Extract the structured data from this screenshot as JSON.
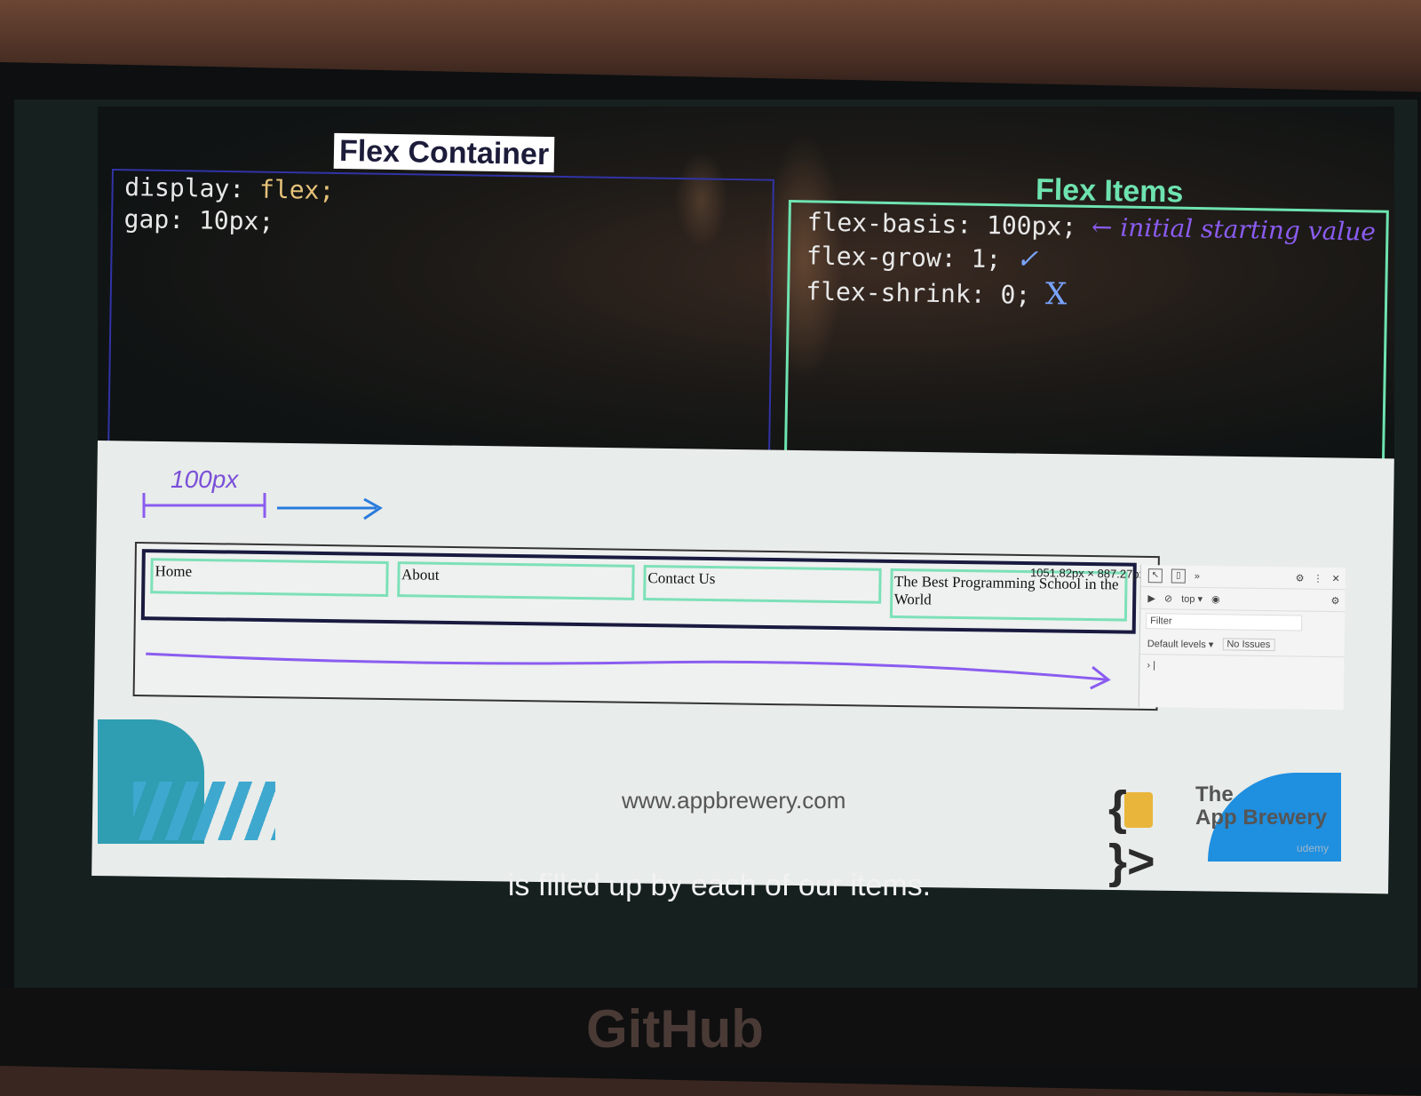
{
  "slide": {
    "flex_container": {
      "title": "Flex Container",
      "code": [
        {
          "prop": "display:",
          "value": "flex;"
        },
        {
          "prop": "gap:",
          "value": "10px;"
        }
      ]
    },
    "flex_items": {
      "title": "Flex Items",
      "code": [
        {
          "prop": "flex-basis:",
          "value": "100px;"
        },
        {
          "prop": "flex-grow:",
          "value": "1;"
        },
        {
          "prop": "flex-shrink:",
          "value": "0;"
        }
      ],
      "annotations": {
        "basis_note": "← initial starting value",
        "grow_mark": "✓",
        "shrink_mark": "X"
      }
    },
    "ruler_label": "100px",
    "nav_items": [
      "Home",
      "About",
      "Contact Us",
      "The Best Programming School in the World"
    ],
    "dimension_readout": "1051.82px × 887.27px",
    "devtools": {
      "context": "top ▾",
      "filter_placeholder": "Filter",
      "levels": "Default levels ▾",
      "issues": "No Issues",
      "prompt": "› |"
    },
    "footer_url": "www.appbrewery.com",
    "brand": {
      "line1": "The",
      "line2": "App Brewery",
      "watermark": "udemy"
    }
  },
  "caption": "is filled up by each of our items.",
  "background_logo": "GitHub",
  "colors": {
    "accent_green": "#6ee3b0",
    "accent_purple": "#8a5cf0",
    "container_blue": "#3133a6"
  }
}
